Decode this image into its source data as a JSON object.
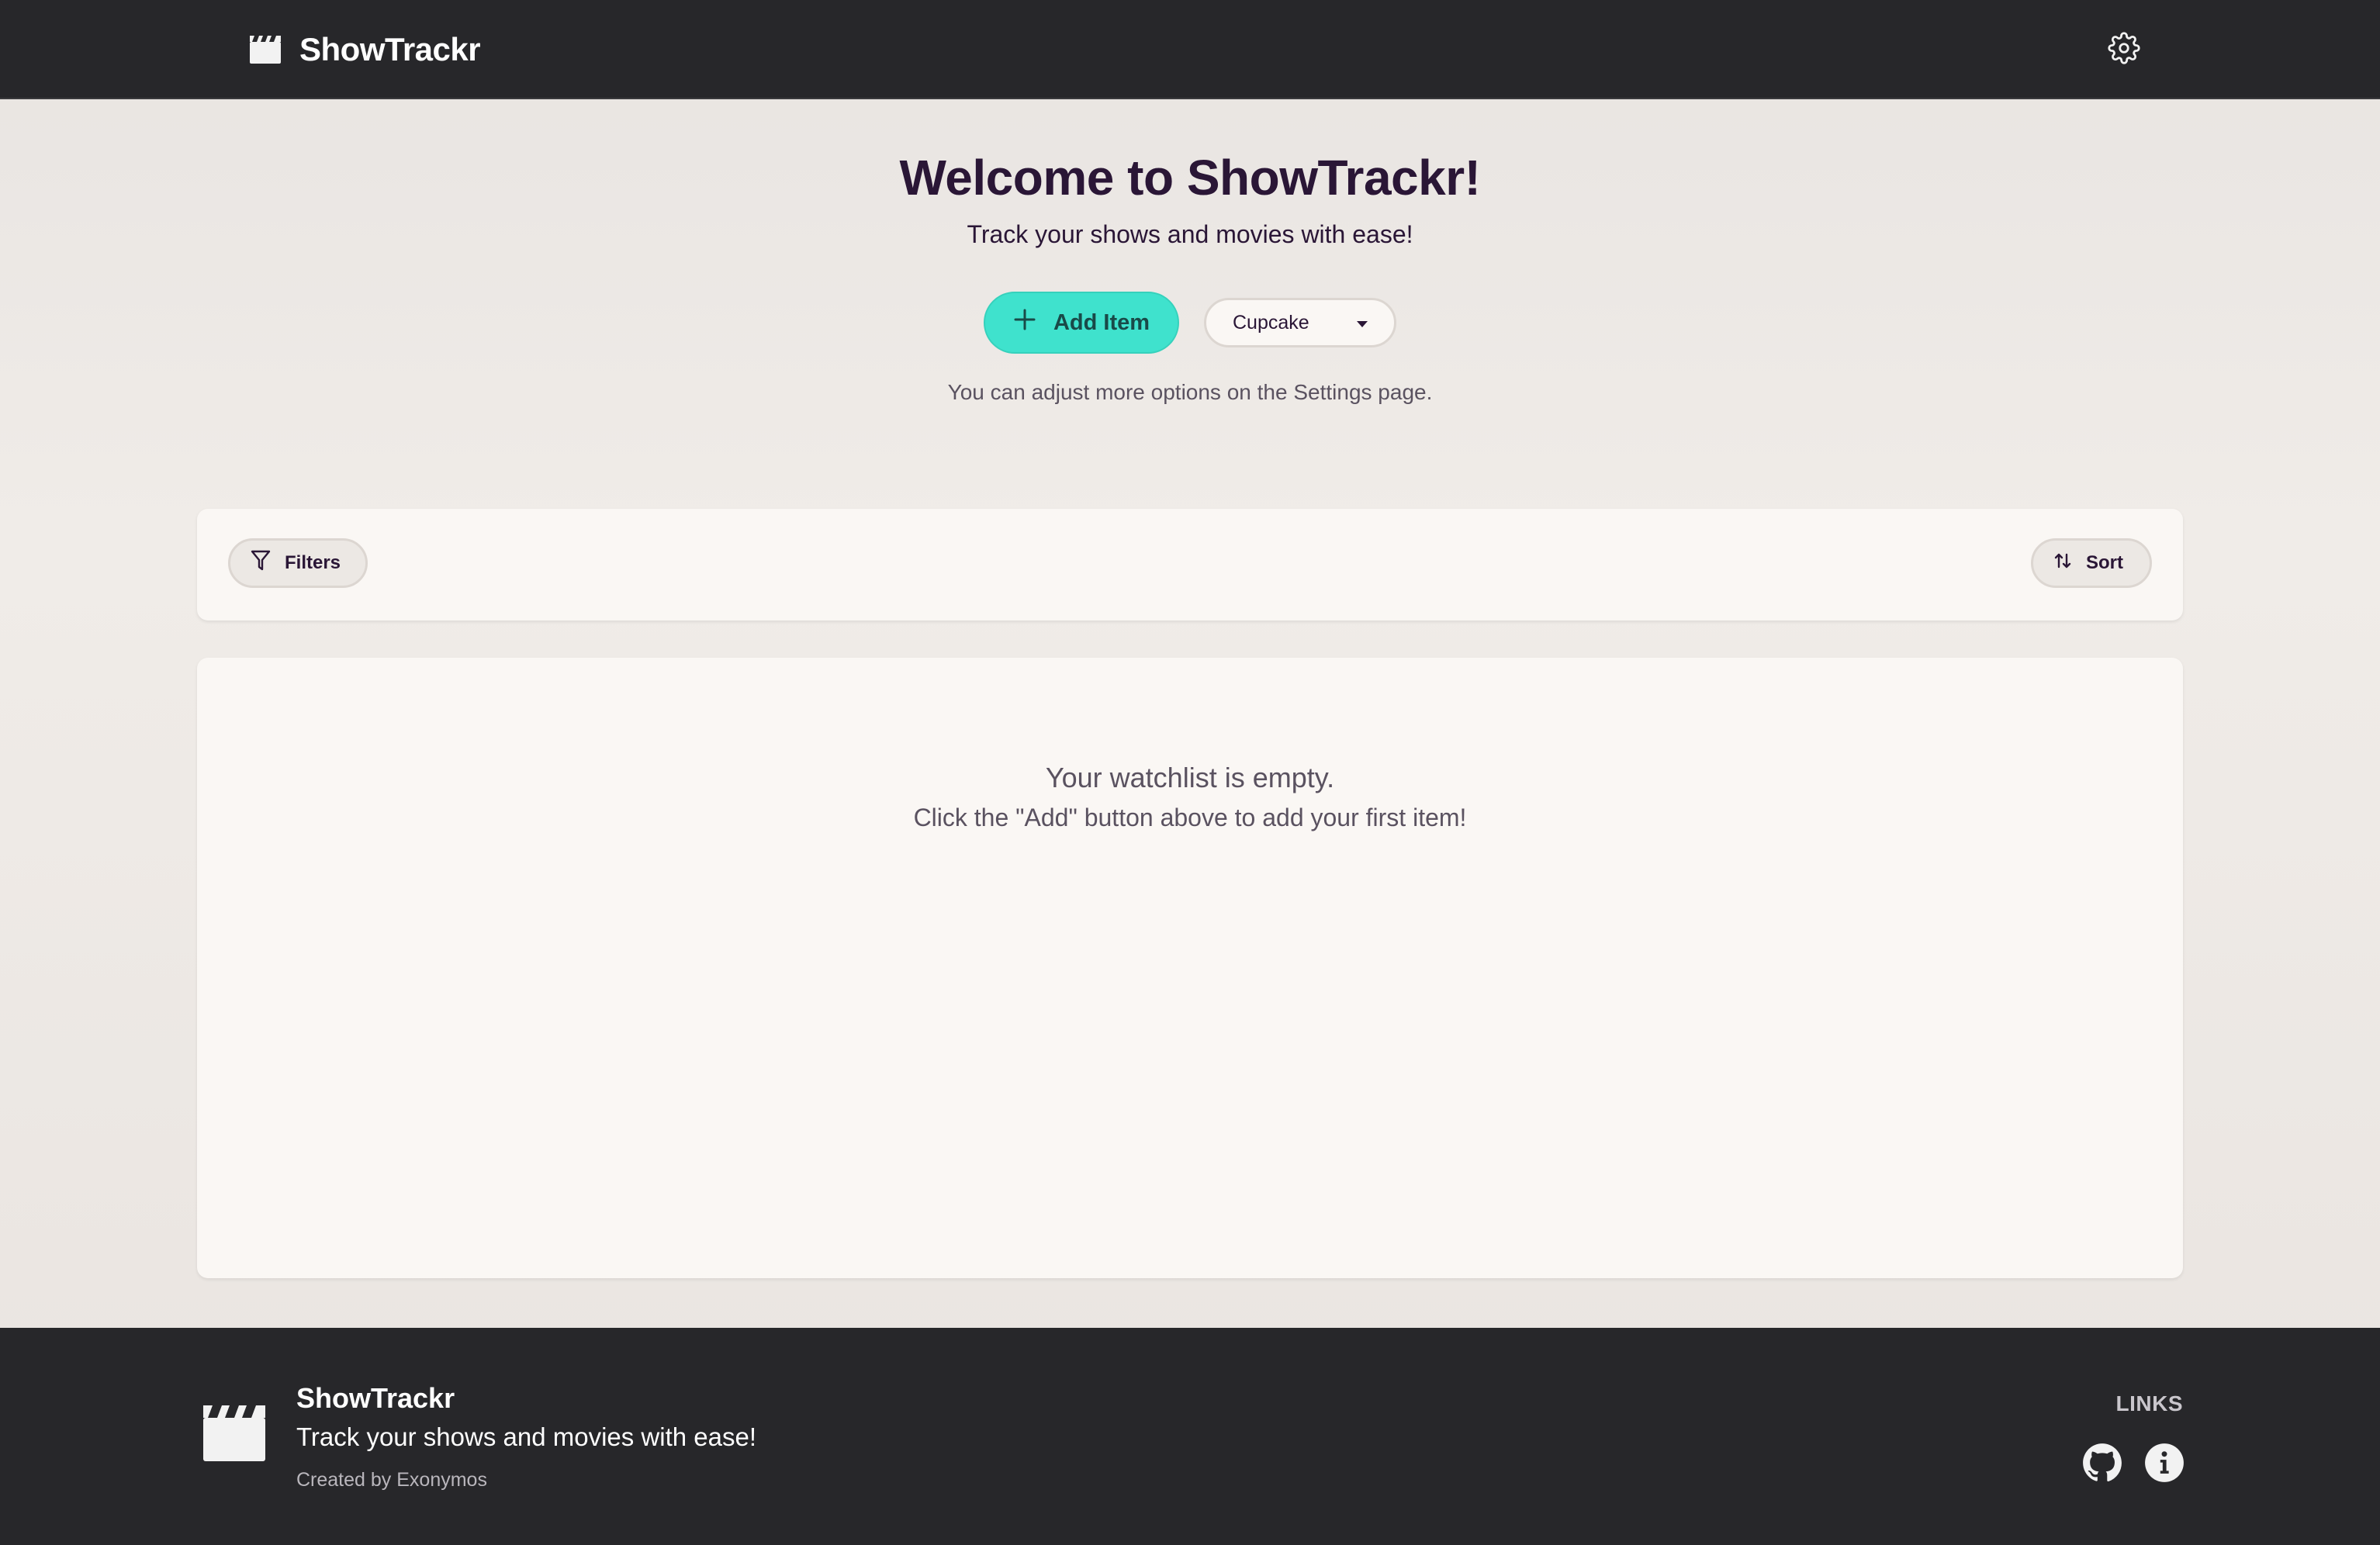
{
  "navbar": {
    "brand": "ShowTrackr",
    "brand_icon": "clapperboard-icon",
    "settings_icon": "gear-icon"
  },
  "hero": {
    "title": "Welcome to ShowTrackr!",
    "subtitle": "Track your shows and movies with ease!",
    "add_button_label": "Add Item",
    "theme_select_value": "Cupcake",
    "hint": "You can adjust more options on the Settings page."
  },
  "toolbar": {
    "filters_label": "Filters",
    "sort_label": "Sort"
  },
  "watchlist": {
    "empty_title": "Your watchlist is empty.",
    "empty_text": "Click the \"Add\" button above to add your first item!"
  },
  "footer": {
    "title": "ShowTrackr",
    "tagline": "Track your shows and movies with ease!",
    "credit": "Created by Exonymos",
    "links_title": "LINKS",
    "links": [
      {
        "icon": "github-icon"
      },
      {
        "icon": "info-icon"
      }
    ]
  },
  "colors": {
    "navbar_bg": "#27272a",
    "primary": "#3fe2cd",
    "card_bg": "#faf7f4",
    "text_dark": "#2a1636"
  }
}
